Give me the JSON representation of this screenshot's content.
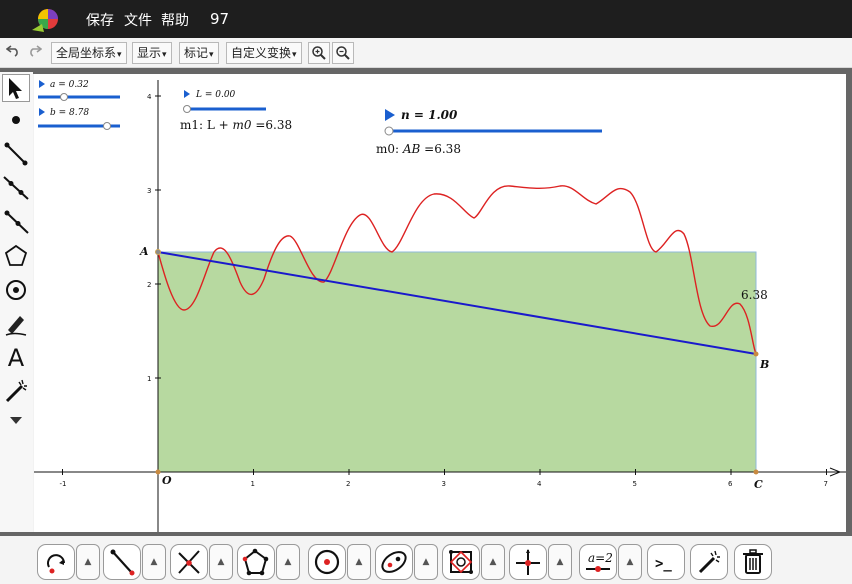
{
  "titlebar": {
    "menu_save": "保存",
    "menu_file": "文件",
    "menu_help": "帮助",
    "count": "97"
  },
  "toolbar": {
    "undo_icon": "undo-icon",
    "redo_icon": "redo-icon",
    "global_coords": "全局坐标系",
    "display": "显示",
    "mark": "标记",
    "custom_transform": "自定义变换",
    "zoom_in_icon": "zoom-in-icon",
    "zoom_out_icon": "zoom-out-icon"
  },
  "sliders": {
    "a": {
      "label": "a = 0.32",
      "value": 0.32
    },
    "b": {
      "label": "b = 8.78",
      "value": 8.78
    },
    "L": {
      "label": "L = 0.00",
      "value": 0.0
    },
    "n": {
      "label": "n = 1.00",
      "value": 1.0
    }
  },
  "texts": {
    "m1_prefix": "m1: L + ",
    "m1_var": "m0",
    "m1_suffix": " =6.38",
    "m0_prefix": "m0: ",
    "m0_var": "AB",
    "m0_suffix": " =6.38",
    "value_label": "6.38"
  },
  "points": {
    "A": "A",
    "B": "B",
    "C": "C",
    "O": "O"
  },
  "axes": {
    "x_ticks": [
      "-1",
      "1",
      "2",
      "3",
      "4",
      "5",
      "6",
      "7"
    ],
    "y_ticks": [
      "1",
      "2",
      "3",
      "4"
    ]
  },
  "colors": {
    "curve": "#dd2222",
    "segment": "#1a1acc",
    "region_fill": "#b7d9a0",
    "region_border": "#8fb9d9"
  },
  "icons": {
    "left_tools": [
      "move-arrow-icon",
      "point-icon",
      "segment-icon",
      "line-icon",
      "ray-icon",
      "polygon-icon",
      "circle-icon",
      "pen-icon",
      "text-icon",
      "magic-wand-icon",
      "expand-down-icon"
    ],
    "bottom_tools": [
      "rotate-arc-icon",
      "segment-tool-icon",
      "intersect-icon",
      "polygon-tool-icon",
      "circle-tool-icon",
      "ellipse-tool-icon",
      "transform-tool-icon",
      "axes-tool-icon",
      "slider-tool-icon",
      "command-icon",
      "magic-icon",
      "trash-icon"
    ]
  },
  "bottom": {
    "slider_tool_label": "a=2",
    "command_label": ">_"
  }
}
